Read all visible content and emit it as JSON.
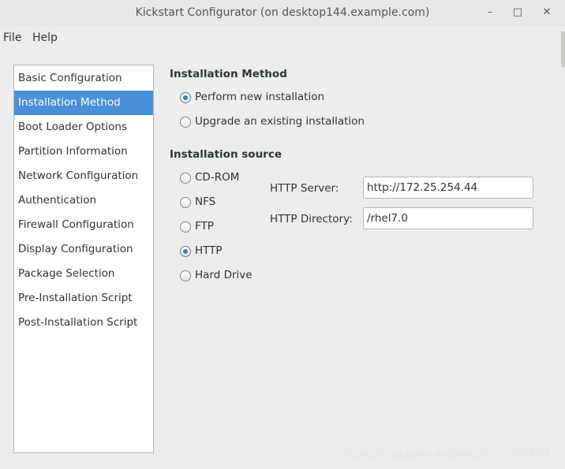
{
  "window": {
    "title": "Kickstart Configurator (on desktop144.example.com)",
    "minimize_glyph": "–",
    "maximize_glyph": "□",
    "close_glyph": "✕"
  },
  "menu": {
    "file": "File",
    "help": "Help"
  },
  "sidebar": {
    "items": [
      {
        "label": "Basic Configuration",
        "selected": false
      },
      {
        "label": "Installation Method",
        "selected": true
      },
      {
        "label": "Boot Loader Options",
        "selected": false
      },
      {
        "label": "Partition Information",
        "selected": false
      },
      {
        "label": "Network Configuration",
        "selected": false
      },
      {
        "label": "Authentication",
        "selected": false
      },
      {
        "label": "Firewall Configuration",
        "selected": false
      },
      {
        "label": "Display Configuration",
        "selected": false
      },
      {
        "label": "Package Selection",
        "selected": false
      },
      {
        "label": "Pre-Installation Script",
        "selected": false
      },
      {
        "label": "Post-Installation Script",
        "selected": false
      }
    ]
  },
  "installation_method": {
    "heading": "Installation Method",
    "options": [
      {
        "label": "Perform new installation",
        "checked": true
      },
      {
        "label": "Upgrade an existing installation",
        "checked": false
      }
    ]
  },
  "installation_source": {
    "heading": "Installation source",
    "options": [
      {
        "label": "CD-ROM",
        "checked": false
      },
      {
        "label": "NFS",
        "checked": false
      },
      {
        "label": "FTP",
        "checked": false
      },
      {
        "label": "HTTP",
        "checked": true
      },
      {
        "label": "Hard Drive",
        "checked": false
      }
    ],
    "http_server_label": "HTTP Server:",
    "http_server_value": "http://172.25.254.44",
    "http_directory_label": "HTTP Directory:",
    "http_directory_value": "/rhel7.0"
  },
  "watermark": "https://blog.csdn.net/weixin_44320876",
  "colors": {
    "selection": "#4a90d9",
    "radio_dot": "#3d7bc6"
  }
}
